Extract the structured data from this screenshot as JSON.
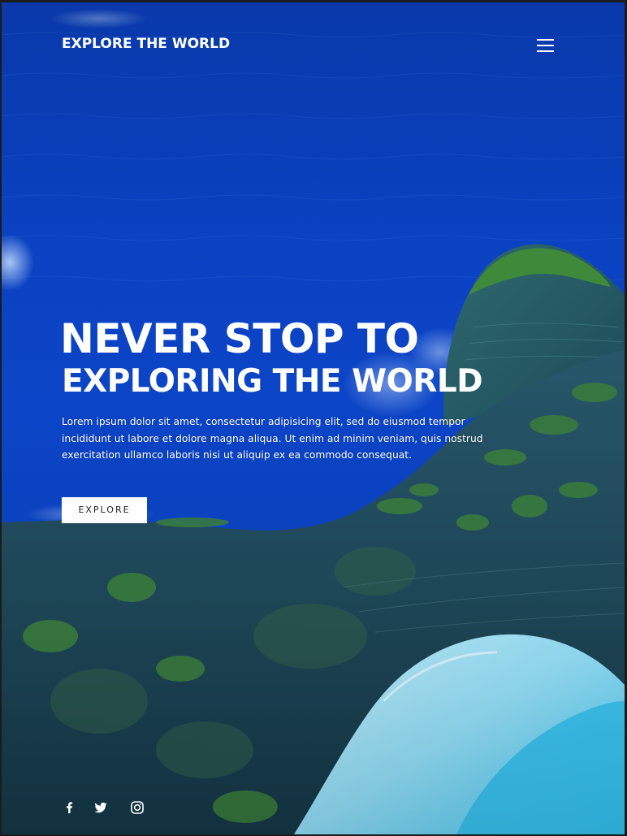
{
  "header": {
    "brand": "EXPLORE THE WORLD",
    "menu_icon": "hamburger-menu-icon"
  },
  "hero": {
    "title_line_1": "NEVER STOP TO",
    "title_line_2": "EXPLORING THE WORLD",
    "description": "Lorem ipsum dolor sit amet, consectetur adipisicing elit, sed do eiusmod tempor incididunt ut labore et dolore magna aliqua. Ut enim ad minim veniam, quis nostrud exercitation ullamco laboris nisi ut aliquip ex ea commodo consequat.",
    "button_label": "EXPLORE"
  },
  "social": [
    {
      "icon": "facebook-icon"
    },
    {
      "icon": "twitter-icon"
    },
    {
      "icon": "instagram-icon"
    }
  ],
  "colors": {
    "ocean": "#0a3ab6",
    "cliff": "#1f4a5a",
    "vegetation": "#3a7a3a",
    "beach": "#7fd0ee",
    "text": "#ffffff",
    "button_bg": "#ffffff",
    "button_text": "#222222"
  }
}
